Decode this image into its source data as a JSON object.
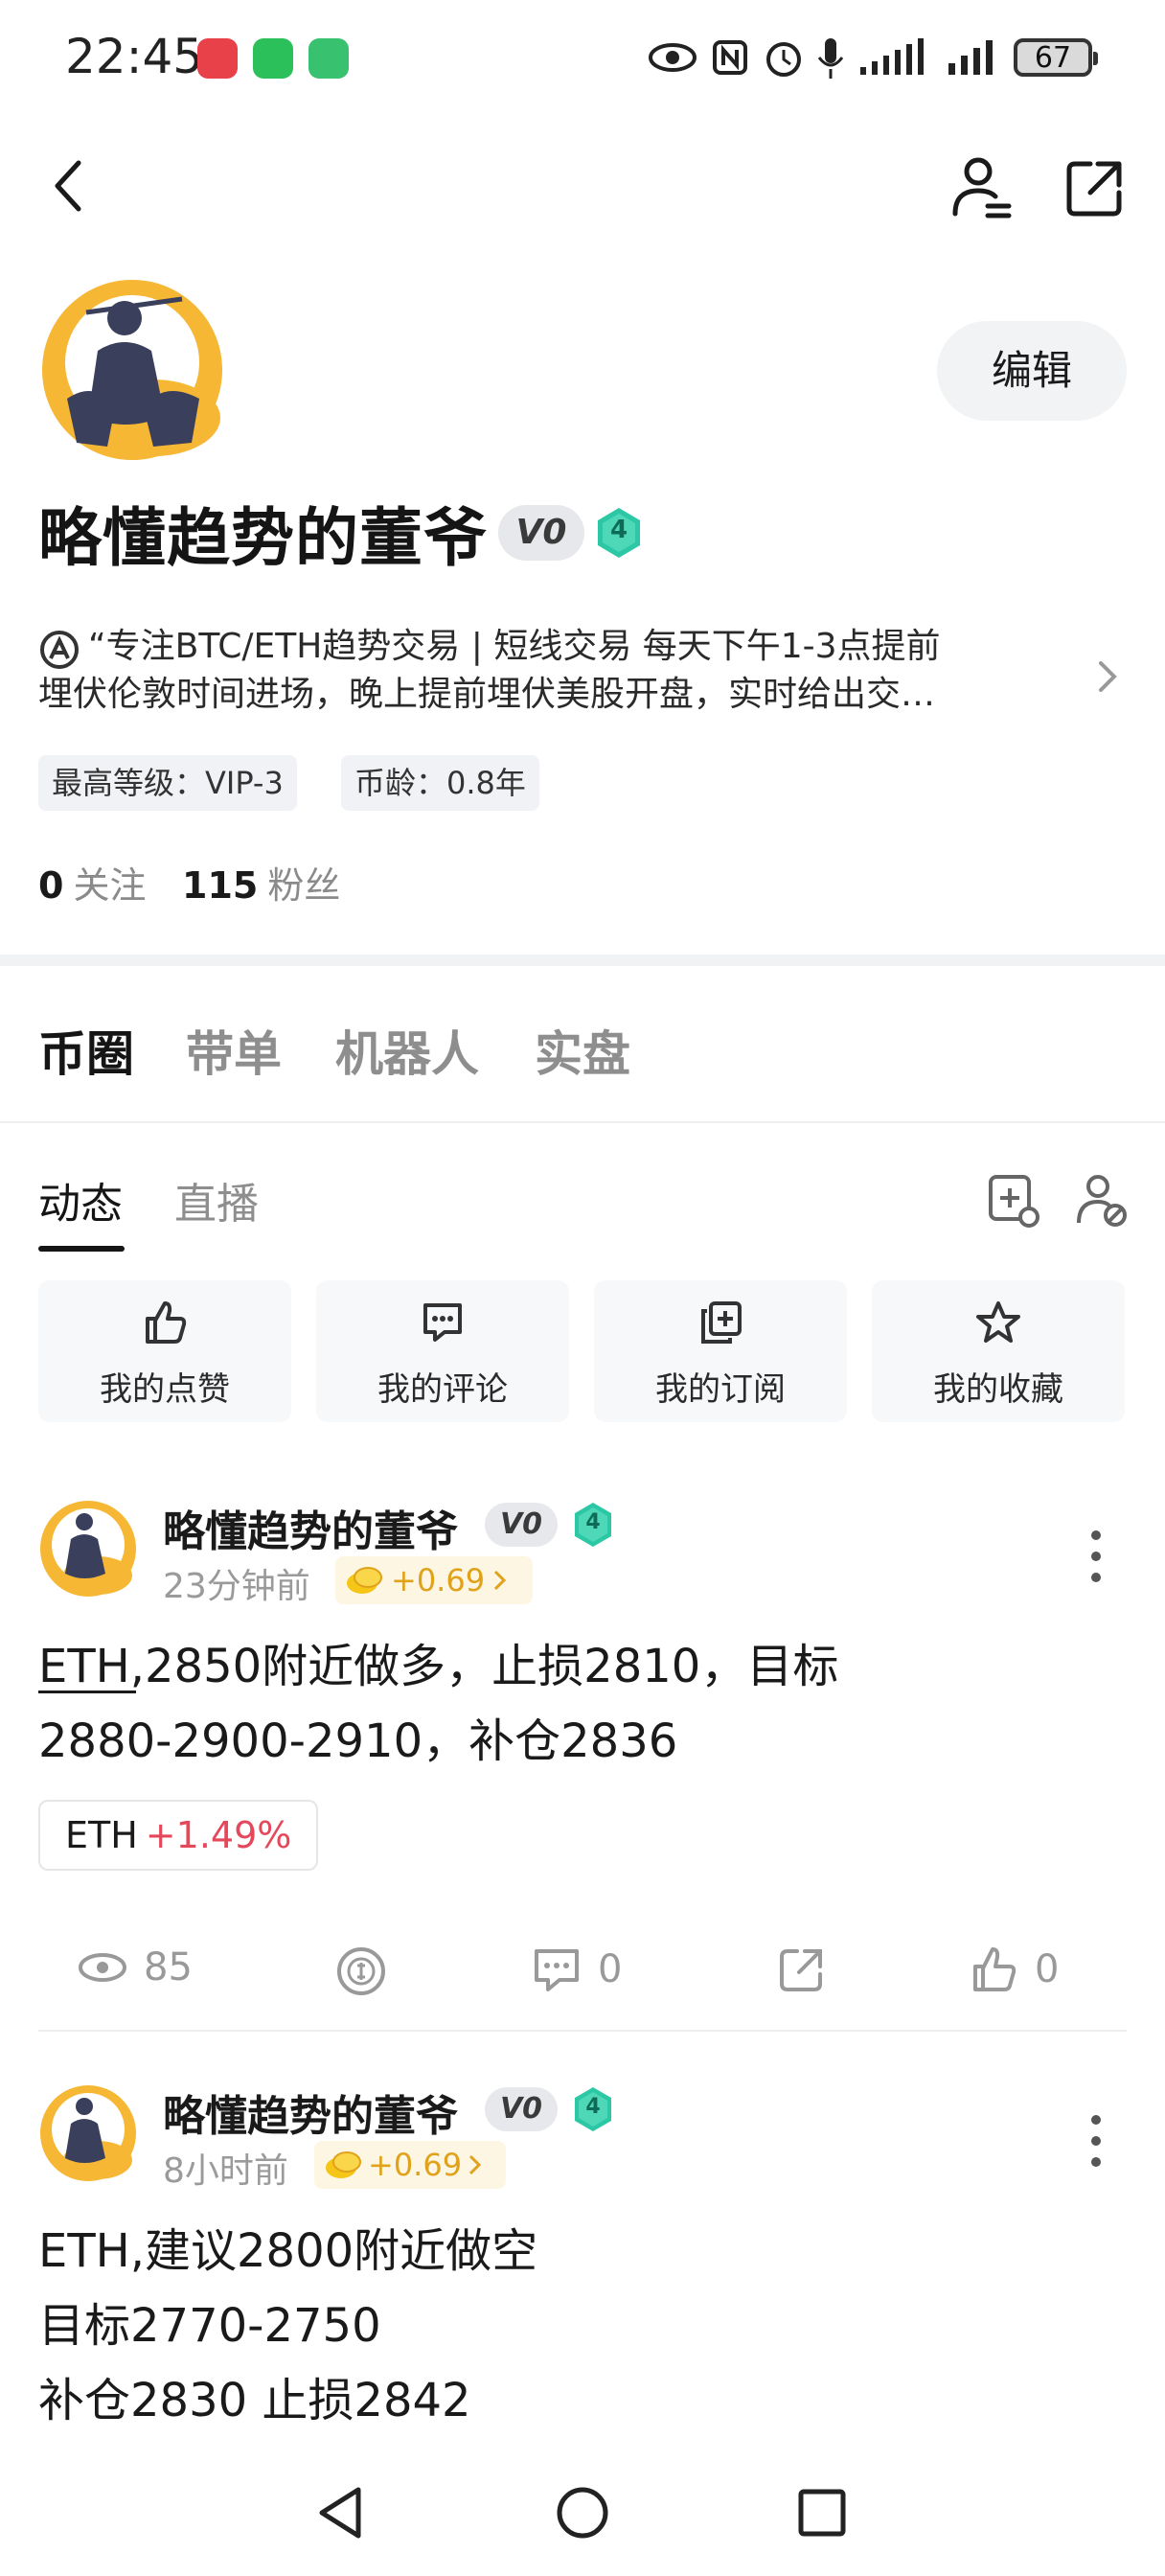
{
  "status_bar": {
    "time": "22:45",
    "battery": "67",
    "icons": [
      "huawei-app-icon",
      "wechat-icon",
      "wechat-alt-icon",
      "eye-icon",
      "nfc-icon",
      "alarm-icon",
      "mic-icon",
      "signal-icon",
      "signal-icon",
      "battery-icon"
    ]
  },
  "nav": {
    "back_icon": "chevron-left-icon",
    "profile_icon": "user-edit-icon",
    "share_icon": "share-icon"
  },
  "profile": {
    "name": "略懂趋势的董爷",
    "vip_badge": "V0",
    "level_badge": "4",
    "edit_label": "编辑",
    "bio_line1": "“专注BTC/ETH趋势交易 | 短线交易 每天下午1-3点提前",
    "bio_line2": "埋伏伦敦时间进场，晚上提前埋伏美股开盘，实时给出交…",
    "tag_level": "最高等级：VIP-3",
    "tag_age": "币龄：0.8年",
    "following_count": "0",
    "following_label": "关注",
    "followers_count": "115",
    "followers_label": "粉丝"
  },
  "main_tabs": [
    "币圈",
    "带单",
    "机器人",
    "实盘"
  ],
  "sub_tabs": [
    "动态",
    "直播"
  ],
  "quick_actions": [
    {
      "label": "我的点赞",
      "icon": "thumbs-up-icon"
    },
    {
      "label": "我的评论",
      "icon": "comment-icon"
    },
    {
      "label": "我的订阅",
      "icon": "subscribe-icon"
    },
    {
      "label": "我的收藏",
      "icon": "star-icon"
    }
  ],
  "posts": [
    {
      "author": "略懂趋势的董爷",
      "vip_badge": "V0",
      "level_badge": "4",
      "time": "23分钟前",
      "coin_reward": "+0.69",
      "text_line1": "ETH,2850附近做多，止损2810，目标",
      "text_line2": "2880-2900-2910，补仓2836",
      "ticker_symbol": "ETH",
      "ticker_change": "+1.49%",
      "views": "85",
      "comments": "0",
      "likes": "0"
    },
    {
      "author": "略懂趋势的董爷",
      "vip_badge": "V0",
      "level_badge": "4",
      "time": "8小时前",
      "coin_reward": "+0.69",
      "text_line1": "ETH,建议2800附近做空",
      "text_line2": "目标2770-2750",
      "text_line3": "补仓2830 止损2842"
    }
  ],
  "colors": {
    "accent_red": "#e5475b",
    "coin_gold": "#e0a21a",
    "level_teal": "#2cc7a5"
  }
}
